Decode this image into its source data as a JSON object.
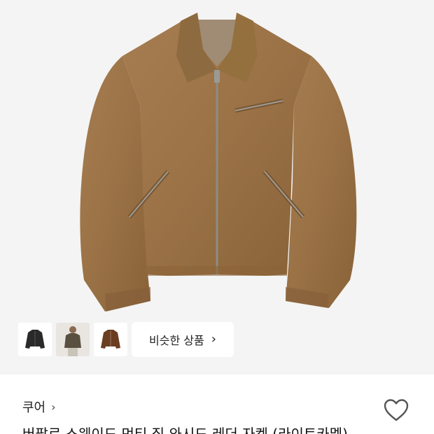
{
  "product": {
    "brand": "쿠어",
    "title": "버팔로 스웨이드 먼티 집 와시드 레더 자켓 (라이트카멜)",
    "colors": {
      "jacket": "#9a7246",
      "jacket_dark": "#7a5632",
      "lining": "#a08c74",
      "background": "#f4f4f4"
    }
  },
  "gallery": {
    "similar_label": "비슷한 상품",
    "thumbs": [
      {
        "name": "black-jacket",
        "color": "#2a2a2a"
      },
      {
        "name": "person-wearing-jacket",
        "color": "#5a5040"
      },
      {
        "name": "brown-jacket",
        "color": "#6b3e22"
      }
    ]
  },
  "icons": {
    "brand_chevron": "chevron-right-icon",
    "similar_chevron": "chevron-right-icon",
    "wishlist": "heart-icon"
  }
}
